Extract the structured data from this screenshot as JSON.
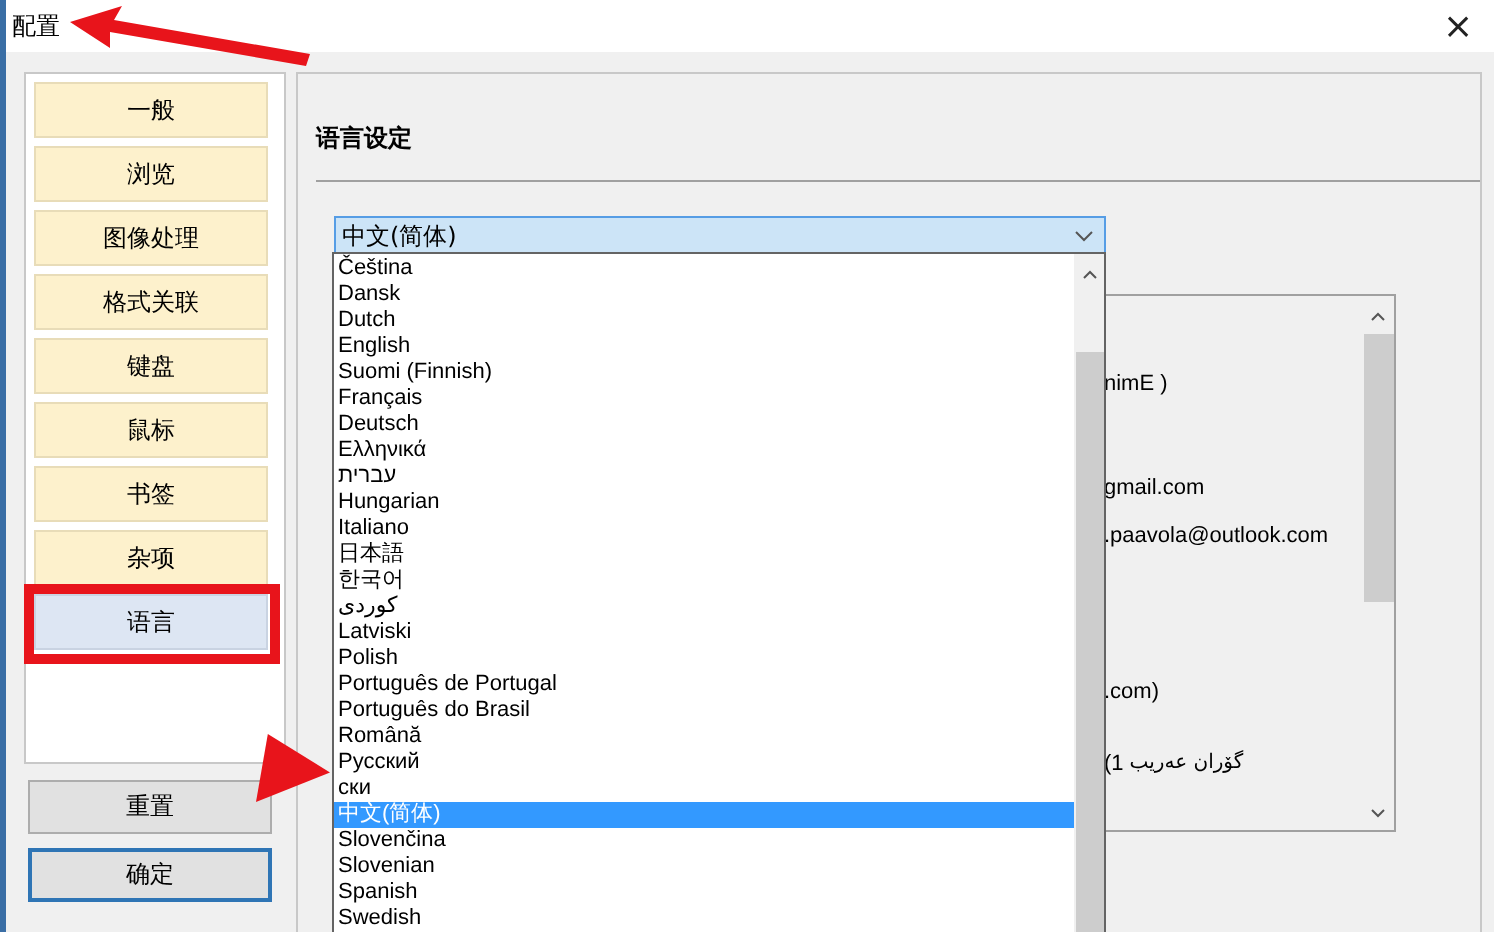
{
  "window": {
    "title": "配置",
    "close": "×"
  },
  "nav": {
    "items": [
      {
        "label": "一般",
        "selected": false
      },
      {
        "label": "浏览",
        "selected": false
      },
      {
        "label": "图像处理",
        "selected": false
      },
      {
        "label": "格式关联",
        "selected": false
      },
      {
        "label": "键盘",
        "selected": false
      },
      {
        "label": "鼠标",
        "selected": false
      },
      {
        "label": "书签",
        "selected": false
      },
      {
        "label": "杂项",
        "selected": false
      },
      {
        "label": "语言",
        "selected": true
      }
    ],
    "buttons": [
      {
        "label": "重置",
        "default": false
      },
      {
        "label": "确定",
        "default": true
      }
    ]
  },
  "panel": {
    "heading": "语言设定",
    "combo": {
      "value": "中文(简体)"
    },
    "dropdown": {
      "items": [
        {
          "label": "Čeština",
          "selected": false
        },
        {
          "label": "Dansk",
          "selected": false
        },
        {
          "label": "Dutch",
          "selected": false
        },
        {
          "label": "English",
          "selected": false
        },
        {
          "label": "Suomi (Finnish)",
          "selected": false
        },
        {
          "label": "Français",
          "selected": false
        },
        {
          "label": "Deutsch",
          "selected": false
        },
        {
          "label": "Ελληνικά",
          "selected": false
        },
        {
          "label": "עברית",
          "selected": false
        },
        {
          "label": "Hungarian",
          "selected": false
        },
        {
          "label": "Italiano",
          "selected": false
        },
        {
          "label": "日本語",
          "selected": false
        },
        {
          "label": "한국어",
          "selected": false
        },
        {
          "label": "کوردی",
          "selected": false
        },
        {
          "label": "Latviski",
          "selected": false
        },
        {
          "label": "Polish",
          "selected": false
        },
        {
          "label": "Português de Portugal",
          "selected": false
        },
        {
          "label": "Português do Brasil",
          "selected": false
        },
        {
          "label": "Română",
          "selected": false
        },
        {
          "label": "Русский",
          "selected": false
        },
        {
          "label": "ски",
          "selected": false
        },
        {
          "label": "中文(简体)",
          "selected": true
        },
        {
          "label": "Slovenčina",
          "selected": false
        },
        {
          "label": "Slovenian",
          "selected": false
        },
        {
          "label": "Spanish",
          "selected": false
        },
        {
          "label": "Swedish",
          "selected": false
        }
      ]
    },
    "credits": {
      "lines": [
        {
          "text": "nimE )"
        },
        {
          "text": "gmail.com"
        },
        {
          "text": ".paavola@outlook.com"
        },
        {
          "text": ".com)"
        },
        {
          "text": "(1",
          "extra": "گۆران عەریب"
        }
      ]
    }
  },
  "annotations": [
    {
      "kind": "arrow-title"
    },
    {
      "kind": "highlight-box"
    },
    {
      "kind": "arrow-list"
    }
  ]
}
